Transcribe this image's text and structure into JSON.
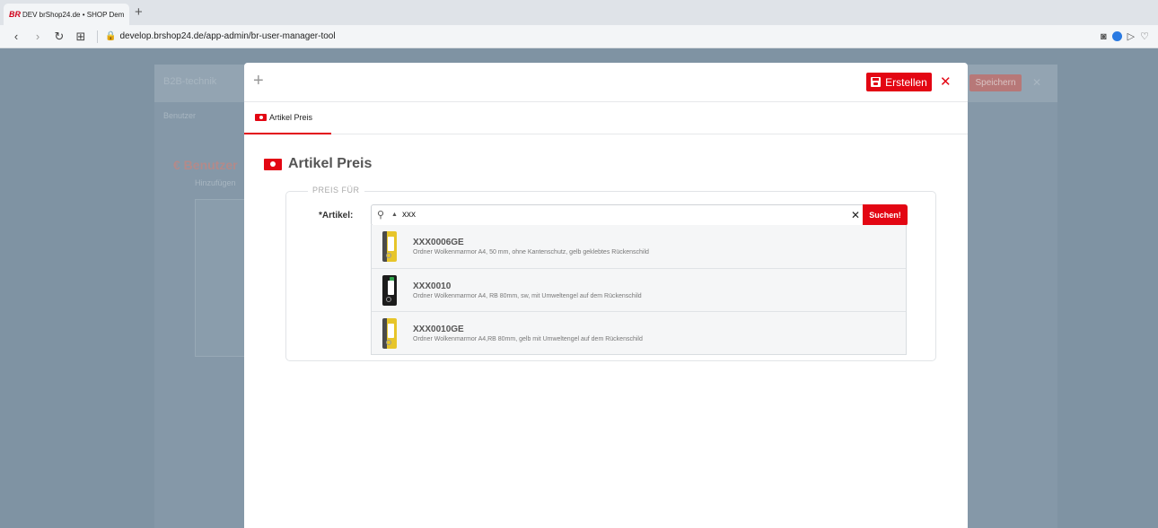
{
  "browser": {
    "tab_logo": "BR",
    "tab_title": "DEV brShop24.de • SHOP Dem",
    "url": "develop.brshop24.de/app-admin/br-user-manager-tool"
  },
  "background": {
    "header_title": "B2B-technik",
    "tab_label": "Benutzer",
    "section_title": "€ Benutzer",
    "subtitle": "Hinzufügen",
    "save_button": "Speichern"
  },
  "modal": {
    "create_button": "Erstellen",
    "tab_label": "Artikel Preis",
    "section_title": "Artikel Preis",
    "fieldset_legend": "PREIS FÜR",
    "article_label": "*Artikel:",
    "search_value": "xxx",
    "search_button": "Suchen!",
    "results": [
      {
        "code": "XXX0006GE",
        "description": "Ordner Wolkenmarmor A4, 50 mm, ohne Kantenschutz, gelb geklebtes Rückenschild",
        "color": "yellow"
      },
      {
        "code": "XXX0010",
        "description": "Ordner Wolkenmarmor A4, RB 80mm, sw, mit Umweltengel auf dem Rückenschild",
        "color": "black"
      },
      {
        "code": "XXX0010GE",
        "description": "Ordner Wolkenmarmor A4,RB 80mm, gelb mit Umweltengel auf dem Rückenschild",
        "color": "yellow"
      }
    ]
  },
  "colors": {
    "accent": "#e30613",
    "overlay": "#7f93a3"
  }
}
